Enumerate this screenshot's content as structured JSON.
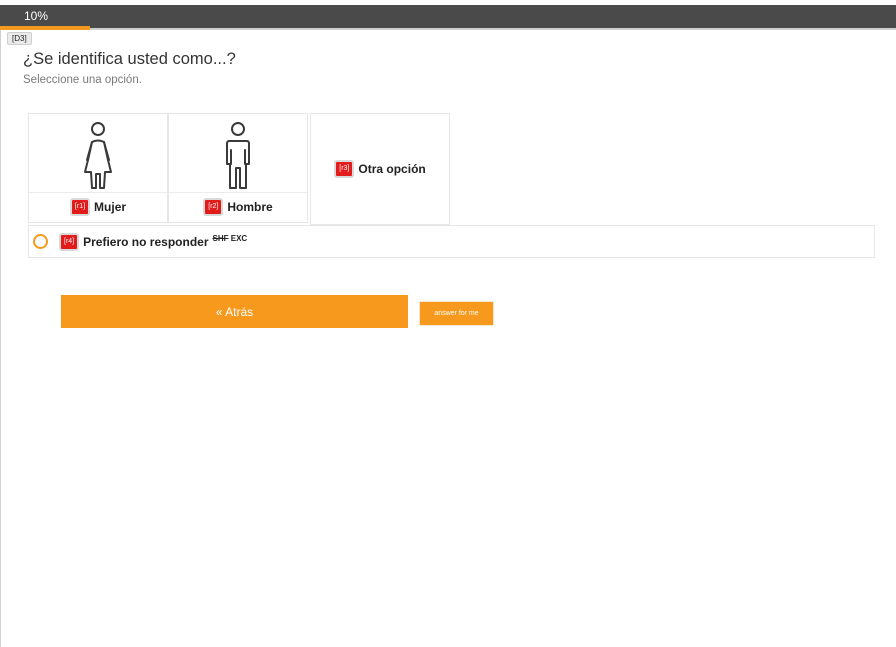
{
  "progress": {
    "label": "10%",
    "value": 0.1
  },
  "page_tag": "[D3]",
  "question": {
    "title": "¿Se identifica usted como...?",
    "instruction": "Seleccione una opción."
  },
  "choices": [
    {
      "code": "[r1]",
      "label": "Mujer",
      "icon": "female-person-icon"
    },
    {
      "code": "[r2]",
      "label": "Hombre",
      "icon": "male-person-icon"
    },
    {
      "code": "[r3]",
      "label": "Otra opción",
      "icon": null
    }
  ],
  "single_option": {
    "code": "[r4]",
    "label": "Prefiero no responder",
    "flag_shf": "SHF",
    "flag_exc": "EXC"
  },
  "buttons": {
    "back": "« Atrás",
    "answer_for_me": "answer for me"
  },
  "colors": {
    "accent": "#f39a1e",
    "tag": "#e21b1b",
    "header": "#4a4a4a"
  }
}
